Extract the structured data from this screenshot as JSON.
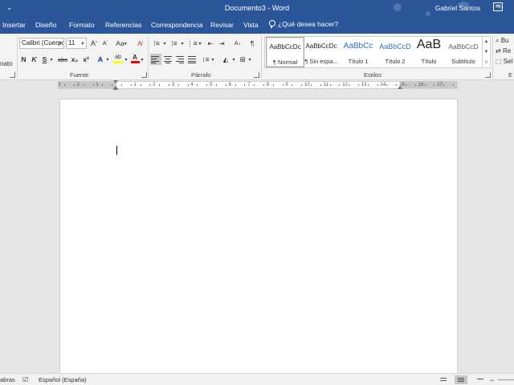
{
  "window": {
    "title": "Documento3 - Word",
    "user": "Gabriel Santos",
    "qat_icon": "customize-quick-access-icon"
  },
  "tabs": [
    "Insertar",
    "Diseño",
    "Formato",
    "Referencias",
    "Correspondencia",
    "Revisar",
    "Vista"
  ],
  "tell_me": {
    "placeholder": "¿Qué desea hacer?"
  },
  "clipboard": {
    "partial_label": "nato"
  },
  "font_group": {
    "label": "Fuente",
    "font_name": "Calibri (Cuerpo",
    "font_size": "11",
    "grow": "A",
    "shrink": "A",
    "case": "Aa",
    "bold": "N",
    "italic": "K",
    "underline": "S",
    "strike": "abc",
    "subscript": "x₂",
    "superscript": "x²",
    "effects": "A",
    "highlight": "ab",
    "font_color": "A",
    "highlight_color": "#ffff00",
    "font_color_value": "#ff0000"
  },
  "paragraph_group": {
    "label": "Párrafo",
    "pilcrow": "¶"
  },
  "styles_group": {
    "label": "Estilos",
    "items": [
      {
        "preview": "AaBbCcDc",
        "name": "¶ Normal",
        "selected": true
      },
      {
        "preview": "AaBbCcDc",
        "name": "¶ Sin espa..."
      },
      {
        "preview": "AaBbCc",
        "name": "Título 1"
      },
      {
        "preview": "AaBbCcD",
        "name": "Título 2"
      },
      {
        "preview": "AaB",
        "name": "Título"
      },
      {
        "preview": "AaBbCcD",
        "name": "Subtítulo"
      }
    ]
  },
  "editing_group": {
    "find": "Bu",
    "replace": "Re",
    "select": "Sel",
    "label_partial": "E"
  },
  "ruler": {
    "numbers": [
      "3",
      "2",
      "1",
      "1",
      "2",
      "3",
      "4",
      "5",
      "6",
      "7",
      "8",
      "9",
      "10",
      "11",
      "12",
      "13",
      "14",
      "15",
      "16",
      "17"
    ]
  },
  "statusbar": {
    "words_partial": "abras",
    "language": "Español (España)"
  },
  "colors": {
    "brand": "#2b579a",
    "ribbon": "#f3f3f3",
    "canvas": "#e6e6e6"
  }
}
